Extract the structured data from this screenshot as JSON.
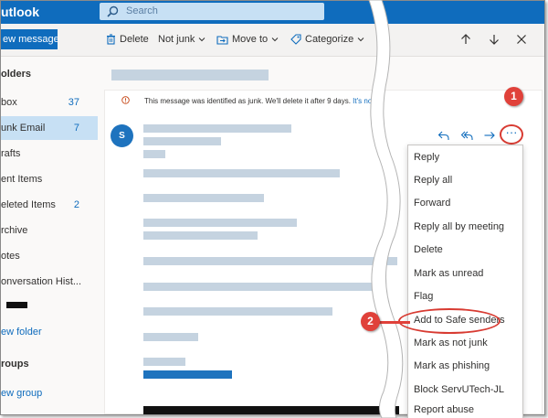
{
  "app": {
    "brand": "utlook"
  },
  "search": {
    "placeholder": "Search"
  },
  "toolbar": {
    "new_message": "ew message",
    "delete": "Delete",
    "not_junk": "Not junk",
    "move_to": "Move to",
    "categorize": "Categorize",
    "more": "···"
  },
  "folders": {
    "header": "olders",
    "items": [
      {
        "label": "box",
        "count": "37"
      },
      {
        "label": "unk Email",
        "count": "7"
      },
      {
        "label": "rafts",
        "count": ""
      },
      {
        "label": "ent Items",
        "count": ""
      },
      {
        "label": "eleted Items",
        "count": "2"
      },
      {
        "label": "rchive",
        "count": ""
      },
      {
        "label": "otes",
        "count": ""
      },
      {
        "label": "onversation Hist...",
        "count": ""
      }
    ],
    "new_folder": "ew folder",
    "groups_header": "roups",
    "new_group": "ew group"
  },
  "message": {
    "junk_notice": "This message was identified as junk. We'll delete it after 9 days.",
    "junk_link": "It's not ju",
    "sender_initial": "S"
  },
  "context_menu": {
    "items": [
      "Reply",
      "Reply all",
      "Forward",
      "Reply all by meeting",
      "Delete",
      "Mark as unread",
      "Flag",
      "Add to Safe senders",
      "Mark as not junk",
      "Mark as phishing",
      "Block ServUTech-JL",
      "Report abuse"
    ]
  },
  "annotations": {
    "step1": "1",
    "step2": "2"
  },
  "colors": {
    "accent": "#0f6cbd",
    "selected": "#c7e0f4",
    "callout": "#e0413a"
  }
}
